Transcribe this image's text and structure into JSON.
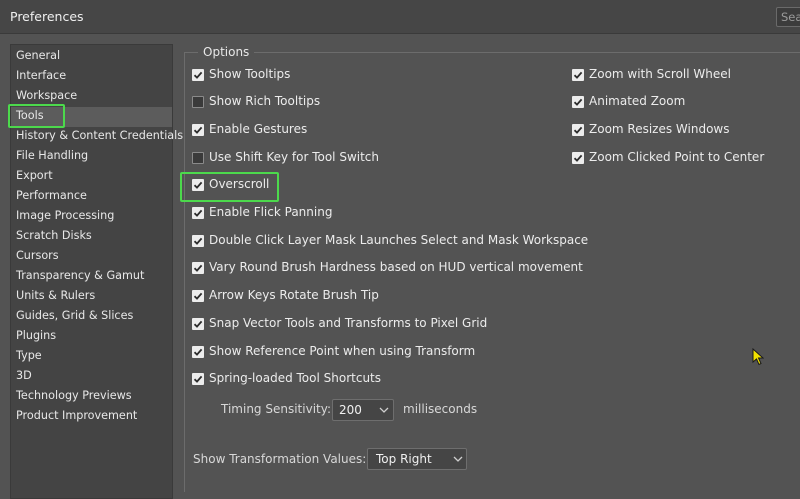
{
  "window": {
    "title": "Preferences",
    "search_placeholder": "Sea"
  },
  "sidebar": {
    "items": [
      {
        "label": "General"
      },
      {
        "label": "Interface"
      },
      {
        "label": "Workspace"
      },
      {
        "label": "Tools"
      },
      {
        "label": "History & Content Credentials"
      },
      {
        "label": "File Handling"
      },
      {
        "label": "Export"
      },
      {
        "label": "Performance"
      },
      {
        "label": "Image Processing"
      },
      {
        "label": "Scratch Disks"
      },
      {
        "label": "Cursors"
      },
      {
        "label": "Transparency & Gamut"
      },
      {
        "label": "Units & Rulers"
      },
      {
        "label": "Guides, Grid & Slices"
      },
      {
        "label": "Plugins"
      },
      {
        "label": "Type"
      },
      {
        "label": "3D"
      },
      {
        "label": "Technology Previews"
      },
      {
        "label": "Product Improvement"
      }
    ],
    "selected": "Tools"
  },
  "options": {
    "legend": "Options",
    "left": [
      {
        "label": "Show Tooltips",
        "checked": true
      },
      {
        "label": "Show Rich Tooltips",
        "checked": false
      },
      {
        "label": "Enable Gestures",
        "checked": true
      },
      {
        "label": "Use Shift Key for Tool Switch",
        "checked": false
      },
      {
        "label": "Overscroll",
        "checked": true
      },
      {
        "label": "Enable Flick Panning",
        "checked": true
      },
      {
        "label": "Double Click Layer Mask Launches Select and Mask Workspace",
        "checked": true
      },
      {
        "label": "Vary Round Brush Hardness based on HUD vertical movement",
        "checked": true
      },
      {
        "label": "Arrow Keys Rotate Brush Tip",
        "checked": true
      },
      {
        "label": "Snap Vector Tools and Transforms to Pixel Grid",
        "checked": true
      },
      {
        "label": "Show Reference Point when using Transform",
        "checked": true
      },
      {
        "label": "Spring-loaded Tool Shortcuts",
        "checked": true
      }
    ],
    "right": [
      {
        "label": "Zoom with Scroll Wheel",
        "checked": true
      },
      {
        "label": "Animated Zoom",
        "checked": true
      },
      {
        "label": "Zoom Resizes Windows",
        "checked": true
      },
      {
        "label": "Zoom Clicked Point to Center",
        "checked": true
      }
    ],
    "timing": {
      "label": "Timing Sensitivity:",
      "value": "200",
      "unit": "milliseconds"
    },
    "transform": {
      "label": "Show Transformation Values:",
      "value": "Top Right"
    }
  },
  "colors": {
    "highlight": "#4cd94c",
    "background": "#535353",
    "sidebar": "#444444"
  }
}
